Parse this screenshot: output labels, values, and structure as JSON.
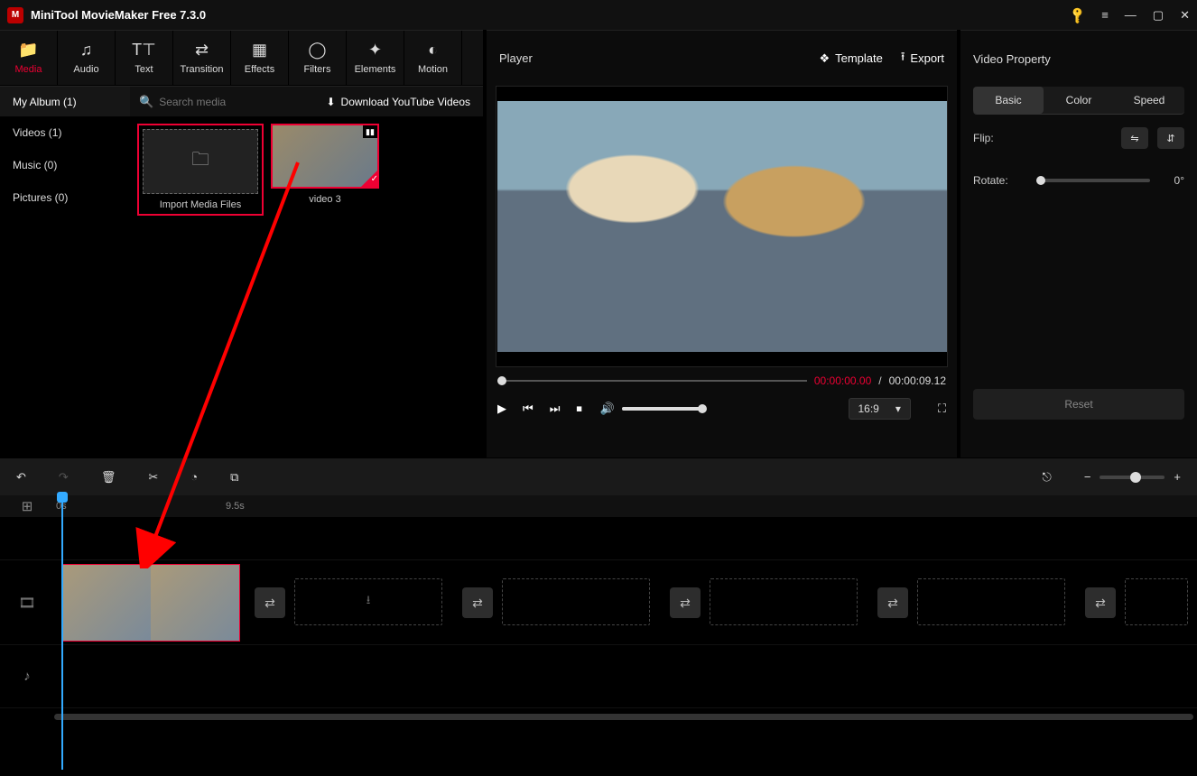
{
  "app": {
    "title": "MiniTool MovieMaker Free 7.3.0"
  },
  "tabs": {
    "media": "Media",
    "audio": "Audio",
    "text": "Text",
    "transition": "Transition",
    "effects": "Effects",
    "filters": "Filters",
    "elements": "Elements",
    "motion": "Motion"
  },
  "sidebar": {
    "album": "My Album (1)",
    "search_placeholder": "Search media",
    "download": "Download YouTube Videos",
    "cats": {
      "videos": "Videos (1)",
      "music": "Music (0)",
      "pictures": "Pictures (0)"
    }
  },
  "import": {
    "label": "Import Media Files"
  },
  "clip": {
    "name": "video 3"
  },
  "player": {
    "title": "Player",
    "template": "Template",
    "export": "Export",
    "time_current": "00:00:00.00",
    "time_sep": "/",
    "time_total": "00:00:09.12",
    "ratio": "16:9"
  },
  "props": {
    "title": "Video Property",
    "tabs": {
      "basic": "Basic",
      "color": "Color",
      "speed": "Speed"
    },
    "flip": "Flip:",
    "rotate": "Rotate:",
    "rotate_value": "0°",
    "reset": "Reset"
  },
  "timeline": {
    "t0": "0s",
    "t1": "9.5s"
  }
}
